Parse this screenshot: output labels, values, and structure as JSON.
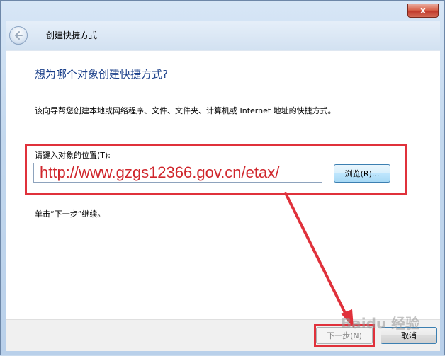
{
  "window": {
    "title": "创建快捷方式",
    "close_glyph": "x"
  },
  "main": {
    "heading": "想为哪个对象创建快捷方式?",
    "description": "该向导帮您创建本地或网络程序、文件、文件夹、计算机或 Internet 地址的快捷方式。",
    "location_label": "请键入对象的位置(T):",
    "location_value": "http://www.gzgs12366.gov.cn/etax/",
    "browse_label": "浏览(R)...",
    "hint": "单击“下一步”继续。"
  },
  "footer": {
    "next_label": "下一步(N)",
    "cancel_label": "取消"
  },
  "annotation": {
    "highlight_color": "#e0313b"
  },
  "watermark": {
    "text": "Baidu 经验"
  }
}
